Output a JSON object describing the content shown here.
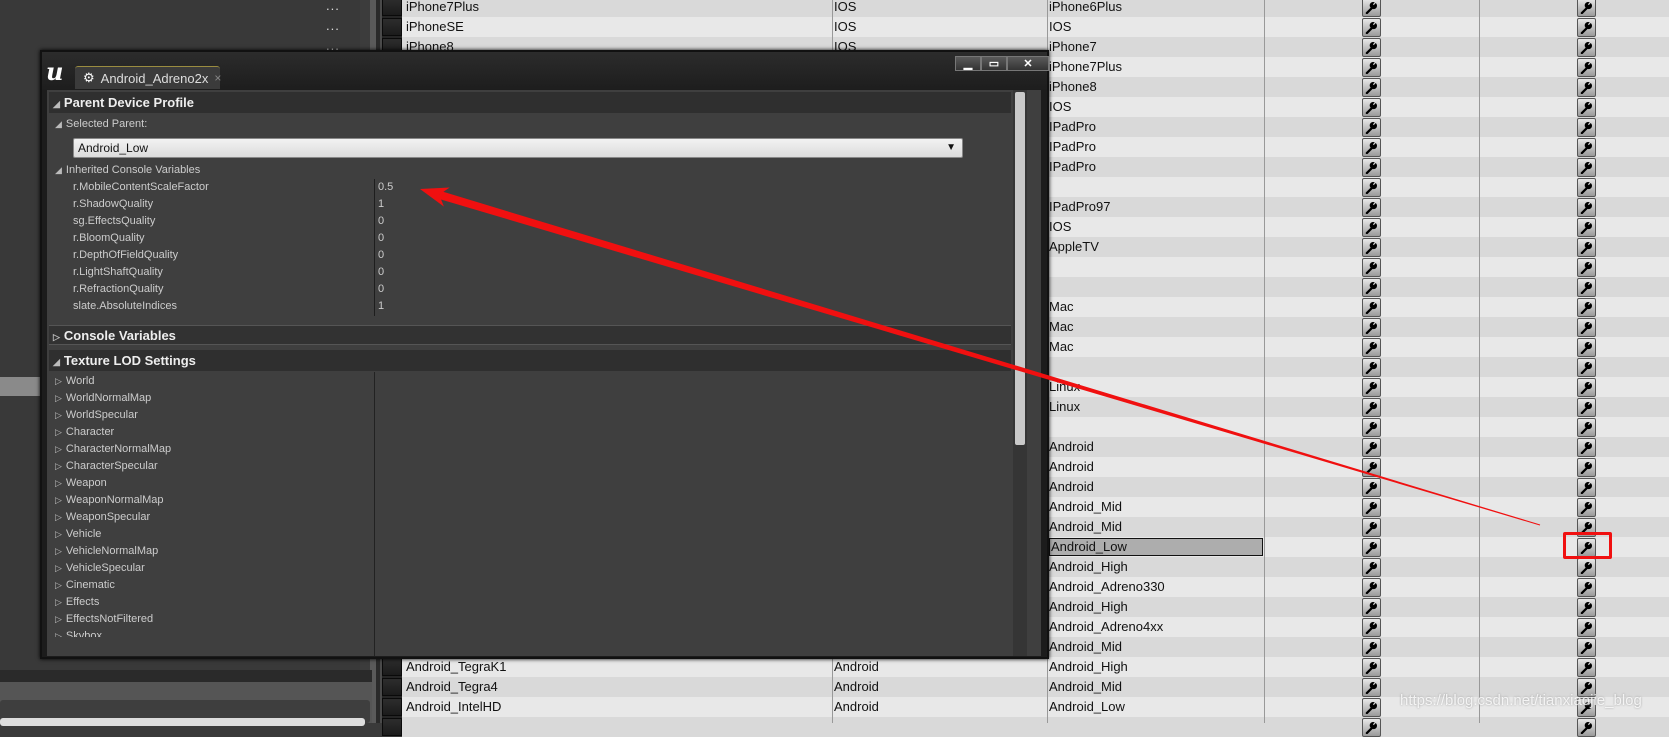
{
  "left_panel": {
    "ellipsis": "...",
    "ellipsis_count": 3
  },
  "table": {
    "rows": [
      [
        "iPhone7Plus",
        "IOS",
        "iPhone6Plus"
      ],
      [
        "iPhoneSE",
        "IOS",
        "IOS"
      ],
      [
        "iPhone8",
        "IOS",
        "iPhone7"
      ],
      [
        "",
        "",
        "iPhone7Plus"
      ],
      [
        "",
        "",
        "iPhone8"
      ],
      [
        "",
        "",
        "IOS"
      ],
      [
        "",
        "",
        "IPadPro"
      ],
      [
        "",
        "",
        "IPadPro"
      ],
      [
        "",
        "",
        "IPadPro"
      ],
      [
        "",
        "",
        ""
      ],
      [
        "",
        "",
        "IPadPro97"
      ],
      [
        "",
        "",
        "IOS"
      ],
      [
        "",
        "",
        "AppleTV"
      ],
      [
        "",
        "",
        ""
      ],
      [
        "",
        "",
        ""
      ],
      [
        "",
        "",
        "Mac"
      ],
      [
        "",
        "",
        "Mac"
      ],
      [
        "",
        "",
        "Mac"
      ],
      [
        "",
        "",
        ""
      ],
      [
        "",
        "",
        "Linux"
      ],
      [
        "",
        "",
        "Linux"
      ],
      [
        "",
        "",
        ""
      ],
      [
        "",
        "",
        "Android"
      ],
      [
        "",
        "",
        "Android"
      ],
      [
        "",
        "",
        "Android"
      ],
      [
        "",
        "",
        "Android_Mid"
      ],
      [
        "",
        "",
        "Android_Mid"
      ],
      [
        "",
        "",
        "Android_Low"
      ],
      [
        "",
        "",
        "Android_High"
      ],
      [
        "",
        "",
        "Android_Adreno330"
      ],
      [
        "",
        "",
        "Android_High"
      ],
      [
        "",
        "",
        "Android_Adreno4xx"
      ],
      [
        "",
        "",
        "Android_Mid"
      ],
      [
        "Android_TegraK1",
        "Android",
        "Android_High"
      ],
      [
        "Android_Tegra4",
        "Android",
        "Android_Mid"
      ],
      [
        "Android_IntelHD",
        "Android",
        "Android_Low"
      ],
      [
        "",
        "",
        ""
      ]
    ],
    "selected_row": 27,
    "highlighted_wrench_row": 27,
    "row_icon": "wrench-icon"
  },
  "dialog": {
    "logo": "unreal-engine-logo",
    "tab_label": "Android_Adreno2x",
    "tab_close": "×",
    "window_buttons": {
      "minimize": "▁",
      "maximize": "▭",
      "close": "✕"
    },
    "parent_header": "Parent Device Profile",
    "selected_parent_label": "Selected Parent:",
    "selected_parent_value": "Android_Low",
    "inherited_header": "Inherited Console Variables",
    "inherited_vars": [
      {
        "name": "r.MobileContentScaleFactor",
        "value": "0.5"
      },
      {
        "name": "r.ShadowQuality",
        "value": "1"
      },
      {
        "name": "sg.EffectsQuality",
        "value": "0"
      },
      {
        "name": "r.BloomQuality",
        "value": "0"
      },
      {
        "name": "r.DepthOfFieldQuality",
        "value": "0"
      },
      {
        "name": "r.LightShaftQuality",
        "value": "0"
      },
      {
        "name": "r.RefractionQuality",
        "value": "0"
      },
      {
        "name": "slate.AbsoluteIndices",
        "value": "1"
      }
    ],
    "console_header": "Console Variables",
    "texture_header": "Texture LOD Settings",
    "texture_groups": [
      "World",
      "WorldNormalMap",
      "WorldSpecular",
      "Character",
      "CharacterNormalMap",
      "CharacterSpecular",
      "Weapon",
      "WeaponNormalMap",
      "WeaponSpecular",
      "Vehicle",
      "VehicleNormalMap",
      "VehicleSpecular",
      "Cinematic",
      "Effects",
      "EffectsNotFiltered",
      "Skybox"
    ]
  },
  "annotation": {
    "color": "#f01010"
  },
  "watermark": "https://blog.csdn.net/tianxiaojie_blog"
}
